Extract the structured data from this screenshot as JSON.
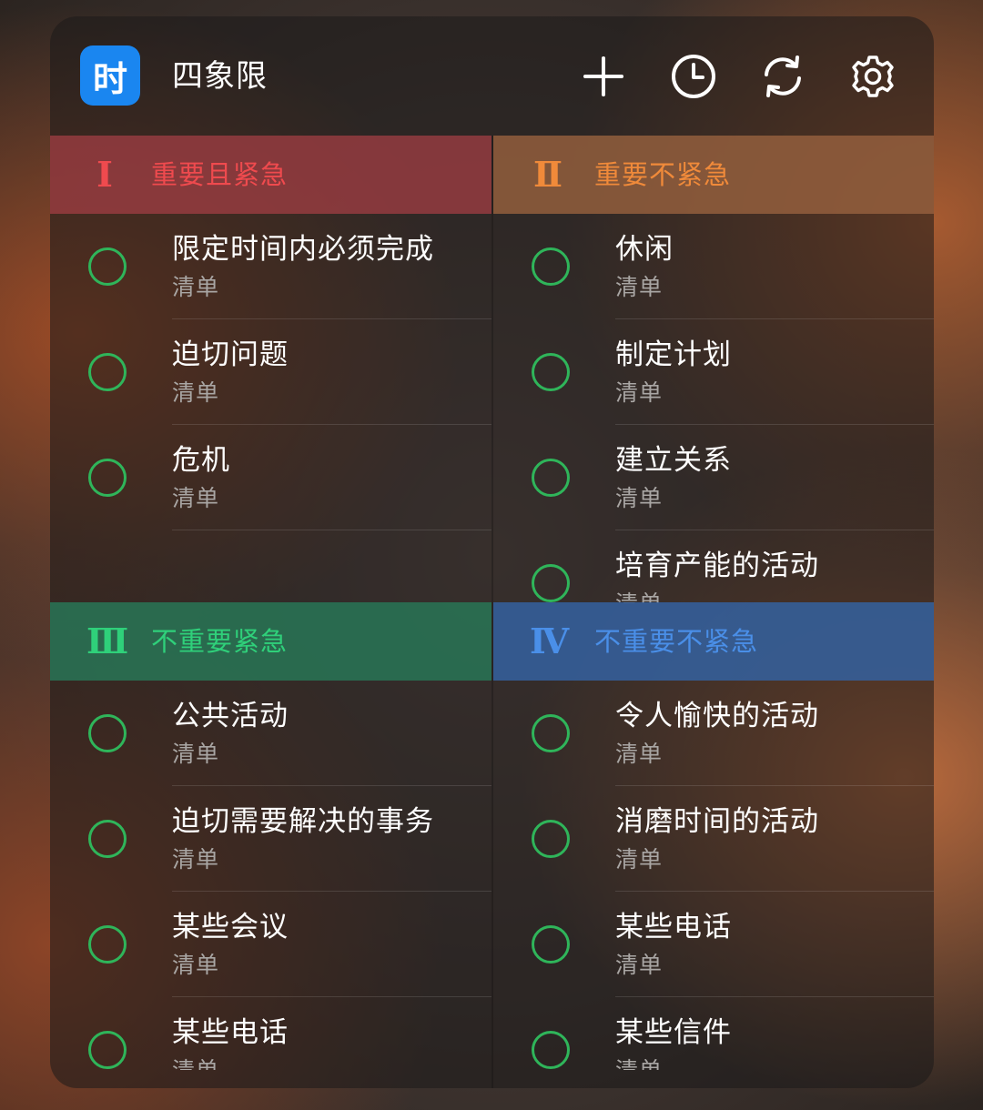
{
  "app": {
    "icon_glyph": "时",
    "title": "四象限",
    "accent": "#1a86f0"
  },
  "toolbar": {
    "add_icon": "plus-icon",
    "history_icon": "clock-icon",
    "sync_icon": "refresh-icon",
    "settings_icon": "gear-icon"
  },
  "quadrants": [
    {
      "numeral": "Ⅰ",
      "title": "重要且紧急",
      "color": "#ef4a4e",
      "items": [
        {
          "title": "限定时间内必须完成",
          "sub": "清单"
        },
        {
          "title": "迫切问题",
          "sub": "清单"
        },
        {
          "title": "危机",
          "sub": "清单"
        }
      ]
    },
    {
      "numeral": "Ⅱ",
      "title": "重要不紧急",
      "color": "#f08a3a",
      "items": [
        {
          "title": "休闲",
          "sub": "清单"
        },
        {
          "title": "制定计划",
          "sub": "清单"
        },
        {
          "title": "建立关系",
          "sub": "清单"
        },
        {
          "title": "培育产能的活动",
          "sub": "清单"
        }
      ]
    },
    {
      "numeral": "Ⅲ",
      "title": "不重要紧急",
      "color": "#2fd07a",
      "items": [
        {
          "title": "公共活动",
          "sub": "清单"
        },
        {
          "title": "迫切需要解决的事务",
          "sub": "清单"
        },
        {
          "title": "某些会议",
          "sub": "清单"
        },
        {
          "title": "某些电话",
          "sub": "清单"
        }
      ]
    },
    {
      "numeral": "Ⅳ",
      "title": "不重要不紧急",
      "color": "#4a8fe8",
      "items": [
        {
          "title": "令人愉快的活动",
          "sub": "清单"
        },
        {
          "title": "消磨时间的活动",
          "sub": "清单"
        },
        {
          "title": "某些电话",
          "sub": "清单"
        },
        {
          "title": "某些信件",
          "sub": "清单"
        }
      ]
    }
  ]
}
